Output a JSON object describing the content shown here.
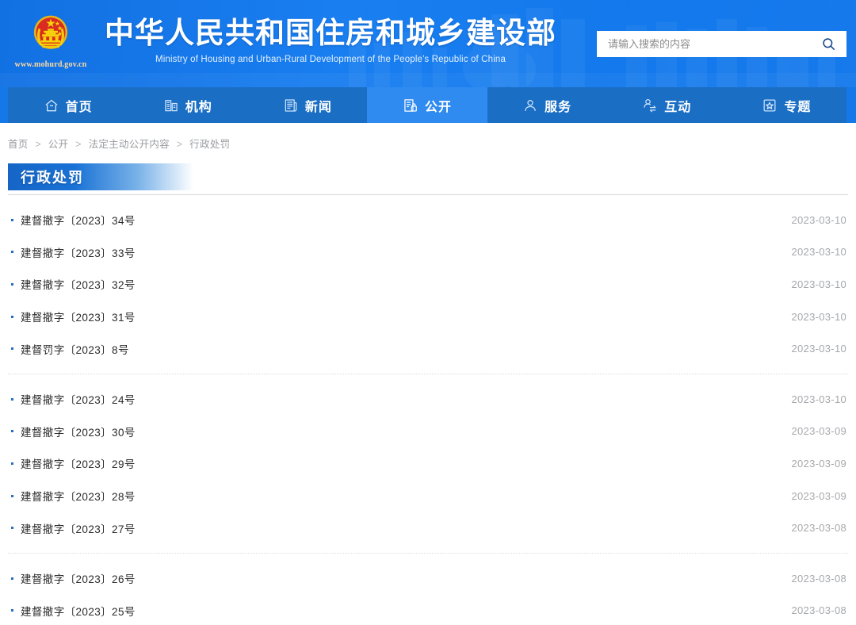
{
  "header": {
    "emblem_icon": "china-national-emblem",
    "site_url": "www.mohurd.gov.cn",
    "title_cn": "中华人民共和国住房和城乡建设部",
    "title_en": "Ministry of Housing and Urban-Rural Development of the People's Republic of China",
    "search": {
      "placeholder": "请输入搜索的内容",
      "value": "",
      "button_icon": "search-icon"
    },
    "colors": {
      "header_bg": "#1478e8",
      "nav_bg": "#1a6ec4",
      "nav_active_bg": "#2f8bf0",
      "title_banner_start": "#1565c6"
    }
  },
  "nav": {
    "items": [
      {
        "label": "首页",
        "icon": "home-icon",
        "active": false
      },
      {
        "label": "机构",
        "icon": "building-icon",
        "active": false
      },
      {
        "label": "新闻",
        "icon": "news-icon",
        "active": false
      },
      {
        "label": "公开",
        "icon": "open-document-icon",
        "active": true
      },
      {
        "label": "服务",
        "icon": "user-service-icon",
        "active": false
      },
      {
        "label": "互动",
        "icon": "interaction-icon",
        "active": false
      },
      {
        "label": "专题",
        "icon": "star-topic-icon",
        "active": false
      }
    ]
  },
  "breadcrumb": {
    "separator": ">",
    "items": [
      "首页",
      "公开",
      "法定主动公开内容",
      "行政处罚"
    ]
  },
  "page": {
    "title": "行政处罚"
  },
  "list": {
    "groups": [
      {
        "rows": [
          {
            "title": "建督撤字〔2023〕34号",
            "date": "2023-03-10"
          },
          {
            "title": "建督撤字〔2023〕33号",
            "date": "2023-03-10"
          },
          {
            "title": "建督撤字〔2023〕32号",
            "date": "2023-03-10"
          },
          {
            "title": "建督撤字〔2023〕31号",
            "date": "2023-03-10"
          },
          {
            "title": "建督罚字〔2023〕8号",
            "date": "2023-03-10"
          }
        ]
      },
      {
        "rows": [
          {
            "title": "建督撤字〔2023〕24号",
            "date": "2023-03-10"
          },
          {
            "title": "建督撤字〔2023〕30号",
            "date": "2023-03-09"
          },
          {
            "title": "建督撤字〔2023〕29号",
            "date": "2023-03-09"
          },
          {
            "title": "建督撤字〔2023〕28号",
            "date": "2023-03-09"
          },
          {
            "title": "建督撤字〔2023〕27号",
            "date": "2023-03-08"
          }
        ]
      },
      {
        "rows": [
          {
            "title": "建督撤字〔2023〕26号",
            "date": "2023-03-08"
          },
          {
            "title": "建督撤字〔2023〕25号",
            "date": "2023-03-08"
          }
        ]
      }
    ]
  }
}
